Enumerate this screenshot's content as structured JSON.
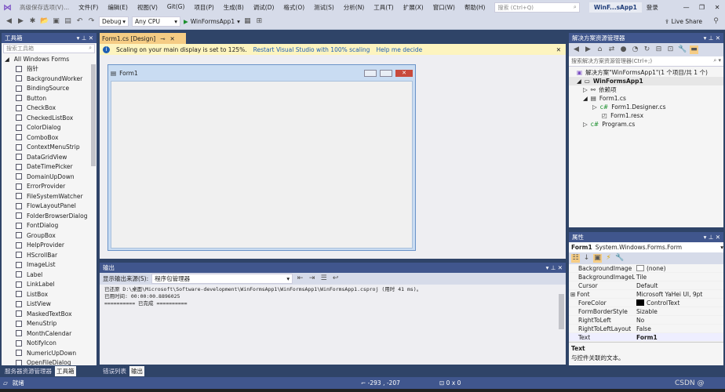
{
  "title_bar": {
    "doc_title": "高级保存选项(V)...",
    "menus": [
      "文件(F)",
      "编辑(E)",
      "视图(V)",
      "Git(G)",
      "项目(P)",
      "生成(B)",
      "调试(D)",
      "格式(O)",
      "测试(S)",
      "分析(N)",
      "工具(T)",
      "扩展(X)",
      "窗口(W)",
      "帮助(H)"
    ],
    "search_placeholder": "搜索 (Ctrl+Q)",
    "app_name": "WinF...sApp1",
    "login": "登录"
  },
  "toolbar": {
    "config": "Debug",
    "platform": "Any CPU",
    "run_target": "WinFormsApp1",
    "live_share": "Live Share"
  },
  "toolbox": {
    "title": "工具箱",
    "search_placeholder": "搜索工具箱",
    "group": "All Windows Forms",
    "items": [
      "指针",
      "BackgroundWorker",
      "BindingSource",
      "Button",
      "CheckBox",
      "CheckedListBox",
      "ColorDialog",
      "ComboBox",
      "ContextMenuStrip",
      "DataGridView",
      "DateTimePicker",
      "DomainUpDown",
      "ErrorProvider",
      "FileSystemWatcher",
      "FlowLayoutPanel",
      "FolderBrowserDialog",
      "FontDialog",
      "GroupBox",
      "HelpProvider",
      "HScrollBar",
      "ImageList",
      "Label",
      "LinkLabel",
      "ListBox",
      "ListView",
      "MaskedTextBox",
      "MenuStrip",
      "MonthCalendar",
      "NotifyIcon",
      "NumericUpDown",
      "OpenFileDialog"
    ],
    "bottom_tabs": [
      "服务器资源管理器",
      "工具箱"
    ]
  },
  "editor": {
    "tab": "Form1.cs [Design]",
    "info": "Scaling on your main display is set to 125%.",
    "info_link1": "Restart Visual Studio with 100% scaling",
    "info_link2": "Help me decide",
    "form_title": "Form1"
  },
  "output": {
    "title": "输出",
    "source_label": "显示输出来源(S):",
    "source_value": "程序包管理器",
    "lines": [
      "已还原 D:\\桌面\\Microsoft\\Software-development\\WinFormsApp1\\WinFormsApp1\\WinFormsApp1.csproj (用时 41 ms)。",
      "已用时间: 00:00:00.8896025",
      "========== 已完成 =========="
    ],
    "bottom_tabs": [
      "错误列表",
      "输出"
    ]
  },
  "solution": {
    "title": "解决方案资源管理器",
    "search_placeholder": "搜索解决方案资源管理器(Ctrl+;)",
    "nodes": [
      "解决方案\"WinFormsApp1\"(1 个项目/共 1 个)",
      "WinFormsApp1",
      "依赖项",
      "Form1.cs",
      "Form1.Designer.cs",
      "Form1.resx",
      "Program.cs"
    ]
  },
  "properties": {
    "title": "属性",
    "object": "Form1",
    "type": "System.Windows.Forms.Form",
    "rows": [
      [
        "BackgroundImage",
        "(none)"
      ],
      [
        "BackgroundImageLayout",
        "Tile"
      ],
      [
        "Cursor",
        "Default"
      ],
      [
        "Font",
        "Microsoft YaHei UI, 9pt"
      ],
      [
        "ForeColor",
        "ControlText"
      ],
      [
        "FormBorderStyle",
        "Sizable"
      ],
      [
        "RightToLeft",
        "No"
      ],
      [
        "RightToLeftLayout",
        "False"
      ],
      [
        "Text",
        "Form1"
      ]
    ],
    "desc_title": "Text",
    "desc": "与控件关联的文本。"
  },
  "status": {
    "text": "就绪",
    "position": "-293 , -207",
    "size": "0 x 0"
  },
  "watermark": "CSDN @",
  "colors": {
    "accent": "#40568d",
    "info_bar": "#fdf4bf",
    "tab_active": "#f5cc84"
  }
}
